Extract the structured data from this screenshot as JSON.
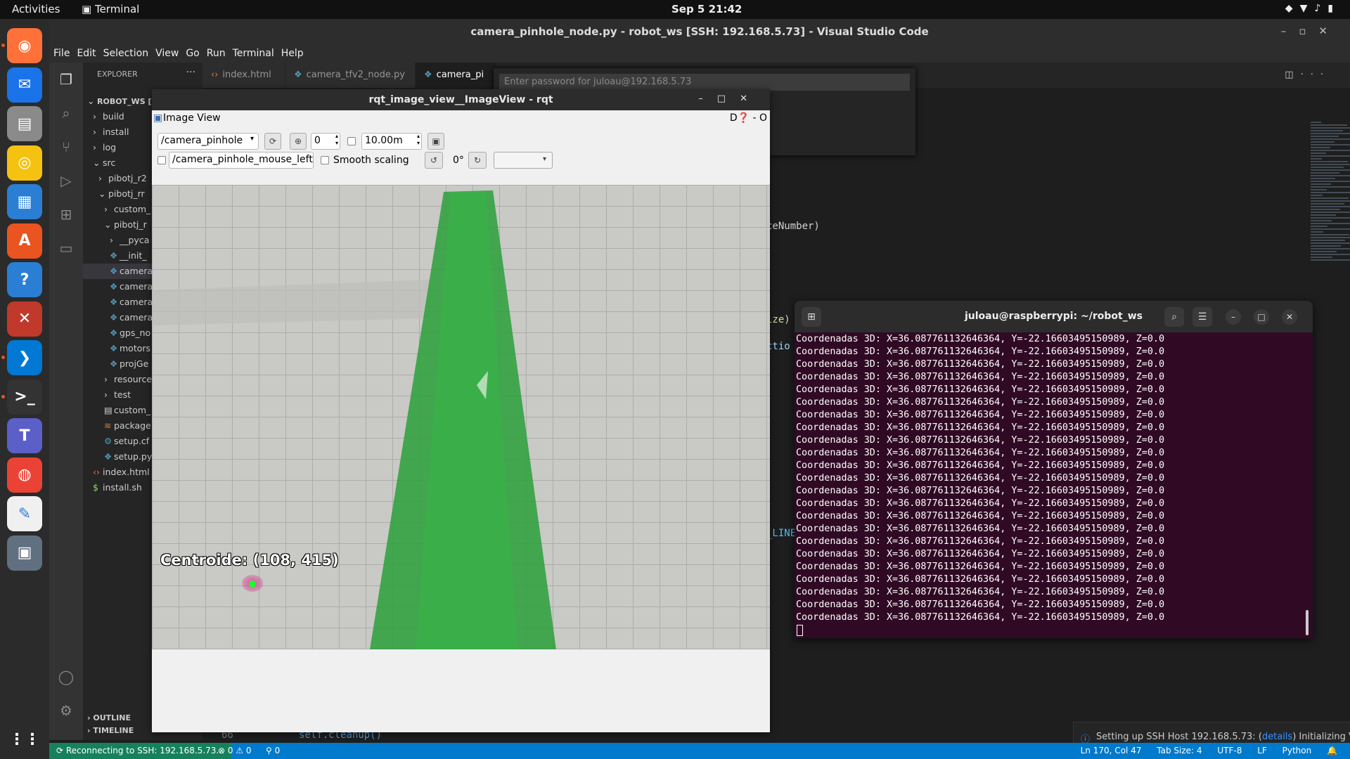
{
  "topbar": {
    "activities": "Activities",
    "app": "Terminal",
    "clock": "Sep 5  21:42"
  },
  "vscode": {
    "title": "camera_pinhole_node.py - robot_ws [SSH: 192.168.5.73] - Visual Studio Code",
    "menu": [
      "File",
      "Edit",
      "Selection",
      "View",
      "Go",
      "Run",
      "Terminal",
      "Help"
    ],
    "explorer_header": "EXPLORER",
    "tree": [
      {
        "label": "ROBOT_WS [SSH:",
        "indent": 0,
        "icon": "chevron-down-icon",
        "bold": true
      },
      {
        "label": "build",
        "indent": 1,
        "icon": "chevron-right-icon"
      },
      {
        "label": "install",
        "indent": 1,
        "icon": "chevron-right-icon"
      },
      {
        "label": "log",
        "indent": 1,
        "icon": "chevron-right-icon"
      },
      {
        "label": "src",
        "indent": 1,
        "icon": "chevron-down-icon"
      },
      {
        "label": "pibotj_r2",
        "indent": 2,
        "icon": "chevron-right-icon"
      },
      {
        "label": "pibotj_rr",
        "indent": 2,
        "icon": "chevron-down-icon"
      },
      {
        "label": "custom_",
        "indent": 3,
        "icon": "chevron-right-icon"
      },
      {
        "label": "pibotj_r",
        "indent": 3,
        "icon": "chevron-down-icon"
      },
      {
        "label": "__pyca",
        "indent": 4,
        "icon": "chevron-right-icon"
      },
      {
        "label": "__init_",
        "indent": 4,
        "icon": "python-file-icon"
      },
      {
        "label": "camera",
        "indent": 4,
        "icon": "python-file-icon",
        "selected": true
      },
      {
        "label": "camera",
        "indent": 4,
        "icon": "python-file-icon"
      },
      {
        "label": "camera",
        "indent": 4,
        "icon": "python-file-icon"
      },
      {
        "label": "camera",
        "indent": 4,
        "icon": "python-file-icon"
      },
      {
        "label": "gps_no",
        "indent": 4,
        "icon": "python-file-icon"
      },
      {
        "label": "motors",
        "indent": 4,
        "icon": "python-file-icon"
      },
      {
        "label": "projGe",
        "indent": 4,
        "icon": "python-file-icon"
      },
      {
        "label": "resource",
        "indent": 3,
        "icon": "chevron-right-icon"
      },
      {
        "label": "test",
        "indent": 3,
        "icon": "chevron-right-icon"
      },
      {
        "label": "custom_",
        "indent": 3,
        "icon": "file-icon"
      },
      {
        "label": "package",
        "indent": 3,
        "icon": "rss-file-icon"
      },
      {
        "label": "setup.cf",
        "indent": 3,
        "icon": "gear-file-icon"
      },
      {
        "label": "setup.py",
        "indent": 3,
        "icon": "python-file-icon"
      },
      {
        "label": "index.html",
        "indent": 1,
        "icon": "html-file-icon"
      },
      {
        "label": "install.sh",
        "indent": 1,
        "icon": "shell-file-icon"
      }
    ],
    "outline": "OUTLINE",
    "timeline": "TIMELINE",
    "tabs": [
      {
        "label": "index.html",
        "icon": "html-file-icon"
      },
      {
        "label": "camera_tfv2_node.py",
        "icon": "python-file-icon"
      },
      {
        "label": "camera_pi",
        "icon": "python-file-icon",
        "active": true
      }
    ],
    "quick_input_placeholder": "Enter password for juloau@192.168.5.73",
    "code_fragments": {
      "frag1": "ceNumber)",
      "frag2": "ize)",
      "frag3": "ctio",
      "frag4": "_LINE",
      "line_no": "66",
      "cleanup": "self.cleanup()"
    },
    "status": {
      "remote": "Reconnecting to SSH: 192.168.5.73...",
      "problems": "⊗ 0 ⚠ 0",
      "ports": "⚲ 0",
      "position": "Ln 170, Col 47",
      "tab_size": "Tab Size: 4",
      "encoding": "UTF-8",
      "eol": "LF",
      "language": "Python"
    },
    "notification": {
      "prefix": "Setting up SSH Host 192.168.5.73: (",
      "link": "details",
      "suffix": ") Initializing VS Code Server"
    }
  },
  "rqt": {
    "title": "rqt_image_view__ImageView - rqt",
    "dock_label": "Image View",
    "dock_right": "D❓  -  O",
    "topic": "/camera_pinhole",
    "zoom_value": "0",
    "max_value": "10.00m",
    "mouse_topic": "/camera_pinhole_mouse_left",
    "smooth_scaling": "Smooth scaling",
    "rotation": "0°",
    "image_overlay_text": "Centroide: (108, 415)"
  },
  "terminal": {
    "title": "juloau@raspberrypi: ~/robot_ws",
    "line": "Coordenadas 3D: X=36.087761132646364, Y=-22.16603495150989, Z=0.0",
    "line_count": 23
  },
  "dock": [
    {
      "name": "firefox-icon",
      "color": "#ff7139"
    },
    {
      "name": "thunderbird-icon",
      "color": "#1a73e8"
    },
    {
      "name": "files-icon",
      "color": "#8a8a8a"
    },
    {
      "name": "rhythmbox-icon",
      "color": "#f5c211"
    },
    {
      "name": "libreoffice-writer-icon",
      "color": "#2a7fd4"
    },
    {
      "name": "app-center-icon",
      "color": "#e95420"
    },
    {
      "name": "help-icon",
      "color": "#2a7fd4"
    },
    {
      "name": "xmind-icon",
      "color": "#c0392b"
    },
    {
      "name": "vscode-icon",
      "color": "#0078d4"
    },
    {
      "name": "terminal-icon",
      "color": "#333"
    },
    {
      "name": "teams-icon",
      "color": "#5b5fc7"
    },
    {
      "name": "chrome-icon",
      "color": "#ea4335"
    },
    {
      "name": "text-editor-icon",
      "color": "#f0f0f0"
    },
    {
      "name": "image-viewer-icon",
      "color": "#607080"
    },
    {
      "name": "show-apps-icon",
      "color": "#2b2b2b"
    }
  ]
}
